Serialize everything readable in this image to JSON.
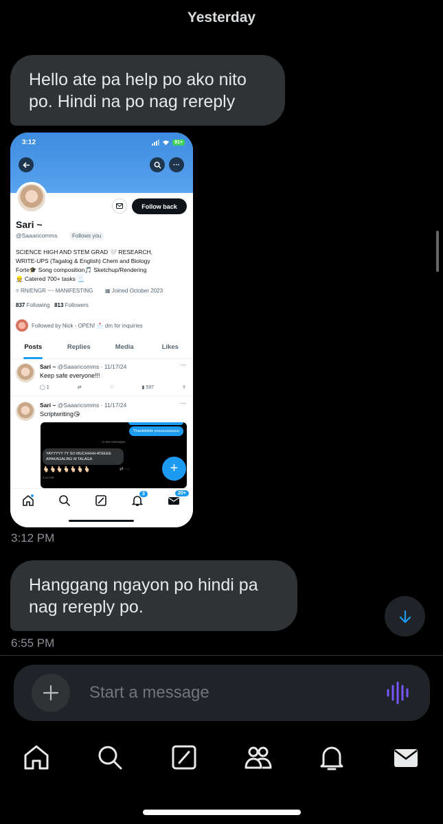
{
  "date_header": "Yesterday",
  "messages": [
    {
      "text": "Hello ate pa help po ako nito po. Hindi na po nag rereply",
      "time": "3:12 PM"
    },
    {
      "text": "Hanggang ngayon po hindi pa nag rereply po.",
      "time": "6:55 PM"
    }
  ],
  "screenshot": {
    "status_time": "3:12",
    "battery": "91+",
    "follow_button": "Follow back",
    "profile": {
      "name": "Sari ~",
      "handle": "@Saaaricomms",
      "follows_you": "Follows you",
      "bio_lines": [
        "SCIENCE HIGH AND STEM GRAD 🤍 RESEARCH,",
        "WRITE-UPS (Tagalog & English) Chem and Biology",
        "Forte🎓 Song composition🎵 Sketchup/Rendering",
        "👷 Catered 700+ tasks 📃"
      ],
      "location": "RN/ENGR ~~ MANIFESTING",
      "joined": "Joined October 2023",
      "following_count": "837",
      "following_label": "Following",
      "followers_count": "813",
      "followers_label": "Followers",
      "followed_by": "Followed by Nick - OPEN! 📩 dm for inquiries"
    },
    "tabs": [
      "Posts",
      "Replies",
      "Media",
      "Likes"
    ],
    "posts": [
      {
        "name": "Sari ~",
        "meta": "@Saaaricomms · 11/17/24",
        "text": "Keep safe everyone!!!",
        "replies": "1",
        "views": "597"
      },
      {
        "name": "Sari ~",
        "meta": "@Saaaricomms · 11/17/24",
        "text": "Scriptwriting😘"
      }
    ],
    "dm_preview": {
      "sent": "Thankkkkkk youuuuuuuuuu",
      "divider": "2 new messages",
      "received": "YAYYYYY TY SO MUCHHHH ATEEEE APAKAGALIBG M TALAGA",
      "emojis": "🫰🏻🫰🏻🫰🏻🫰🏻🫰🏻🫰🏻🫰🏻",
      "time": "3:12 AM"
    },
    "notif_badge": "3",
    "mail_badge": "20+"
  },
  "composer": {
    "placeholder": "Start a message"
  },
  "colors": {
    "accent": "#1d9bf0",
    "bubble": "#2f3336",
    "voice": "#7856ff"
  }
}
